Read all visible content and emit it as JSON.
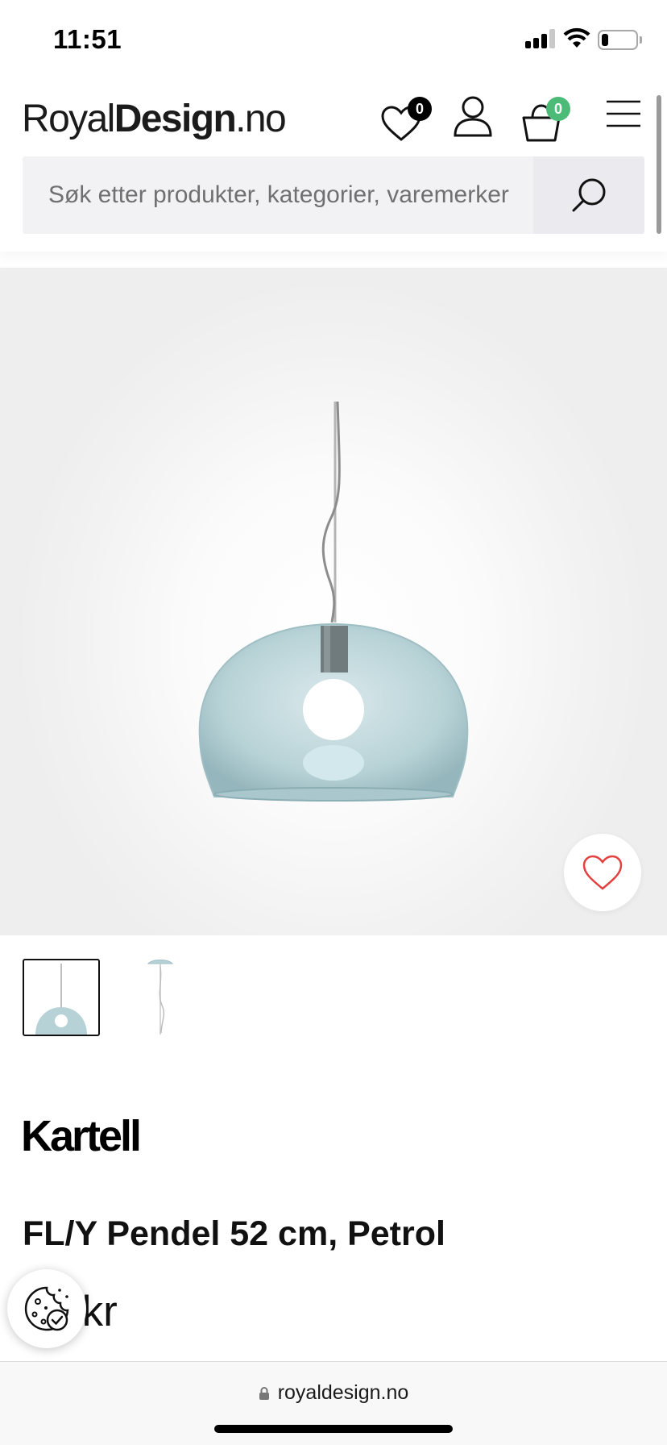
{
  "status_bar": {
    "time": "11:51",
    "signal_icon": "cellular-signal-icon",
    "wifi_icon": "wifi-icon",
    "battery_icon": "battery-icon",
    "battery_level": 0.2
  },
  "header": {
    "logo": {
      "light": "Royal",
      "bold": "Design",
      "suffix": ".no"
    },
    "wishlist": {
      "icon": "heart-icon",
      "count": "0"
    },
    "account": {
      "icon": "user-icon"
    },
    "cart": {
      "icon": "shopping-basket-icon",
      "count": "0"
    },
    "menu": {
      "icon": "hamburger-menu-icon"
    },
    "search": {
      "placeholder": "Søk etter produkter, kategorier, varemerker",
      "icon": "search-icon"
    }
  },
  "product": {
    "image_alt": "Pendant lamp",
    "favorite_icon": "heart-outline-icon",
    "thumbnails": [
      {
        "label": "thumbnail-1",
        "selected": true
      },
      {
        "label": "thumbnail-2",
        "selected": false
      }
    ],
    "brand": "Kartell",
    "title": "FL/Y Pendel 52 cm, Petrol",
    "price": "28 kr"
  },
  "cookie_button": {
    "icon": "cookie-icon"
  },
  "browser": {
    "lock_icon": "lock-icon",
    "url": "royaldesign.no"
  },
  "colors": {
    "accent_green": "#4cbb78",
    "favorite_red": "#e2413f",
    "lamp_petrol": "#b9d4d8"
  }
}
